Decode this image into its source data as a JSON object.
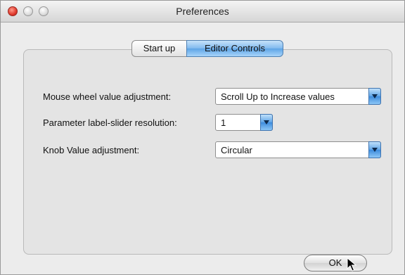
{
  "window": {
    "title": "Preferences"
  },
  "tabs": [
    {
      "label": "Start up",
      "selected": false
    },
    {
      "label": "Editor Controls",
      "selected": true
    }
  ],
  "settings": {
    "mouse_wheel": {
      "label": "Mouse wheel value adjustment:",
      "value": "Scroll Up to Increase values"
    },
    "slider_resolution": {
      "label": "Parameter label-slider resolution:",
      "value": "1"
    },
    "knob": {
      "label": "Knob Value adjustment:",
      "value": "Circular"
    }
  },
  "buttons": {
    "ok_label": "OK"
  },
  "colors": {
    "accent": "#5ea4e6",
    "window_bg": "#ececec",
    "panel_bg": "#e4e4e4"
  },
  "icons": [
    "close-icon",
    "minimize-icon",
    "zoom-icon",
    "chevron-down-icon",
    "mouse-pointer-icon"
  ]
}
